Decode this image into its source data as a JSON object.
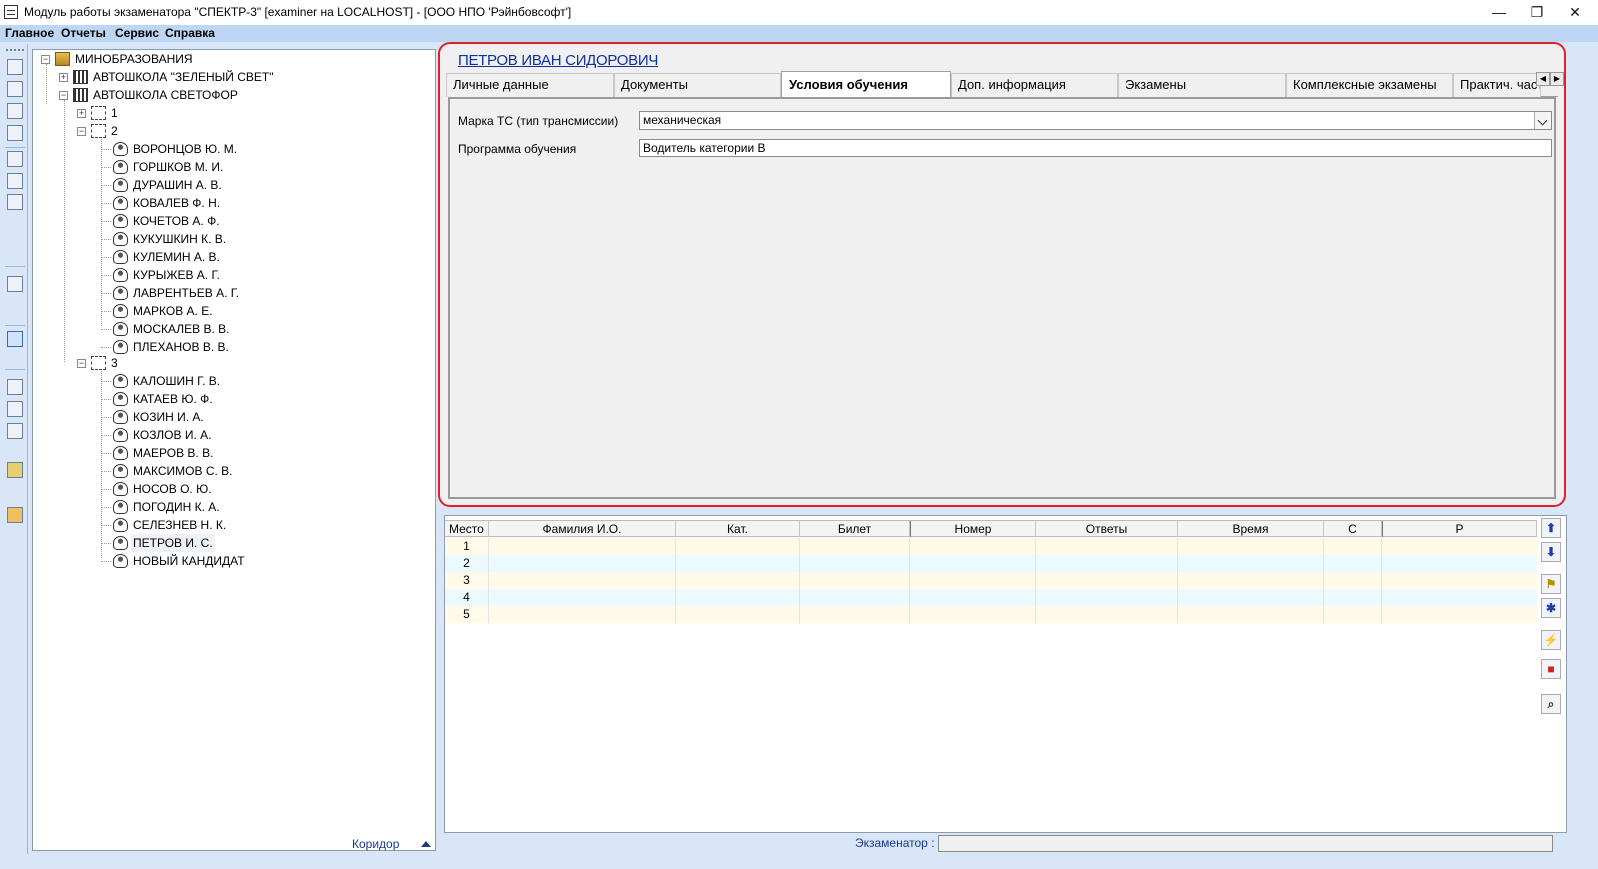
{
  "window": {
    "title": "Модуль работы экзаменатора \"СПЕКТР-3\" [examiner на LOCALHOST] - [ООО НПО 'Рэйнбовсофт']",
    "minimize": "—",
    "restore": "❐",
    "close": "✕"
  },
  "menu": {
    "items": [
      "Главное",
      "Отчеты",
      "Сервис",
      "Справка"
    ]
  },
  "tree": {
    "root": "МИНОБРАЗОВАНИЯ",
    "school1": "АВТОШКОЛА \"ЗЕЛЕНЫЙ СВЕТ\"",
    "school2": "АВТОШКОЛА СВЕТОФОР",
    "group1": "1",
    "group2": "2",
    "group2_members": [
      "ВОРОНЦОВ Ю. М.",
      "ГОРШКОВ М. И.",
      "ДУРАШИН А. В.",
      "КОВАЛЕВ Ф. Н.",
      "КОЧЕТОВ А. Ф.",
      "КУКУШКИН К. В.",
      "КУЛЕМИН А. В.",
      "КУРЫЖЕВ А. Г.",
      "ЛАВРЕНТЬЕВ А. Г.",
      "МАРКОВ А. Е.",
      "МОСКАЛЕВ В. В.",
      "ПЛЕХАНОВ В. В."
    ],
    "group3": "3",
    "group3_members": [
      "КАЛОШИН Г. В.",
      "КАТАЕВ Ю. Ф.",
      "КОЗИН И. А.",
      "КОЗЛОВ И. А.",
      "МАЕРОВ В. В.",
      "МАКСИМОВ С. В.",
      "НОСОВ О. Ю.",
      "ПОГОДИН К. А.",
      "СЕЛЕЗНЕВ Н. К.",
      "ПЕТРОВ И. С.",
      "НОВЫЙ КАНДИДАТ"
    ],
    "selected": "ПЕТРОВ И. С.",
    "expand_plus": "+",
    "expand_minus": "−"
  },
  "corridor": {
    "label": "Коридор"
  },
  "detail": {
    "person_name": "ПЕТРОВ ИВАН СИДОРОВИЧ",
    "tabs": [
      "Личные данные",
      "Документы",
      "Условия обучения",
      "Доп. информация",
      "Экзамены",
      "Комплексные экзамены",
      "Практич. часть"
    ],
    "active_tab": "Условия обучения",
    "tab_scroll_left": "◀",
    "tab_scroll_right": "▶",
    "fields": {
      "transmission_label": "Марка ТС (тип трансмиссии)",
      "transmission_value": "механическая",
      "program_label": "Программа обучения",
      "program_value": "Водитель категории B"
    }
  },
  "queue": {
    "columns": [
      "Место",
      "Фамилия И.О.",
      "Кат.",
      "Билет",
      "Номер",
      "Ответы",
      "Время",
      "С",
      "Р"
    ],
    "rows": [
      "1",
      "2",
      "3",
      "4",
      "5"
    ]
  },
  "side_tools": {
    "icons": [
      "arrow-up-icon",
      "arrow-down-icon",
      "flag-icon",
      "puzzle-icon",
      "lightning-icon",
      "stop-icon",
      "zoom-icon"
    ],
    "glyphs": [
      "⬆",
      "⬇",
      "⚑",
      "✱",
      "⚡",
      "■",
      "⌕"
    ]
  },
  "status": {
    "examiner_label": "Экзаменатор :",
    "examiner_value": ""
  },
  "colors": {
    "accent_border": "#e0202a",
    "name_link": "#1030a0",
    "menubar": "#bcd6f3",
    "row_odd": "#fffbe8",
    "row_even": "#eafaff"
  }
}
